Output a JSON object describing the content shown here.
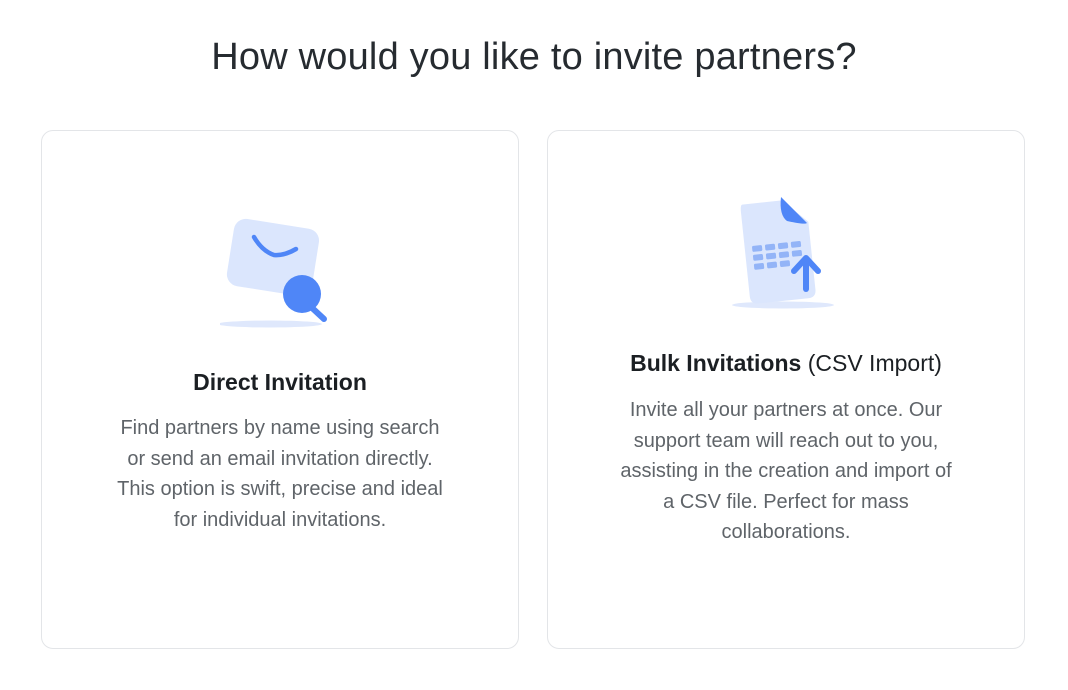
{
  "page": {
    "title": "How would you like to invite partners?"
  },
  "options": {
    "direct": {
      "title": "Direct Invitation",
      "description": "Find partners by name using search\nor send an email invitation directly.\nThis option is swift, precise and ideal\nfor individual invitations.",
      "icon": "envelope-search-icon"
    },
    "bulk": {
      "title": "Bulk Invitations",
      "title_suffix": "(CSV Import)",
      "description": "Invite all your partners at once. Our\nsupport team will reach out to you,\nassisting in the creation and import of\na CSV file. Perfect for mass\ncollaborations.",
      "icon": "csv-upload-icon"
    }
  },
  "colors": {
    "accent": "#4f86f7",
    "accent_light": "#dbe6fd",
    "card_border": "#e3e5e8",
    "title_text": "#262b30",
    "body_text": "#5f6469"
  }
}
